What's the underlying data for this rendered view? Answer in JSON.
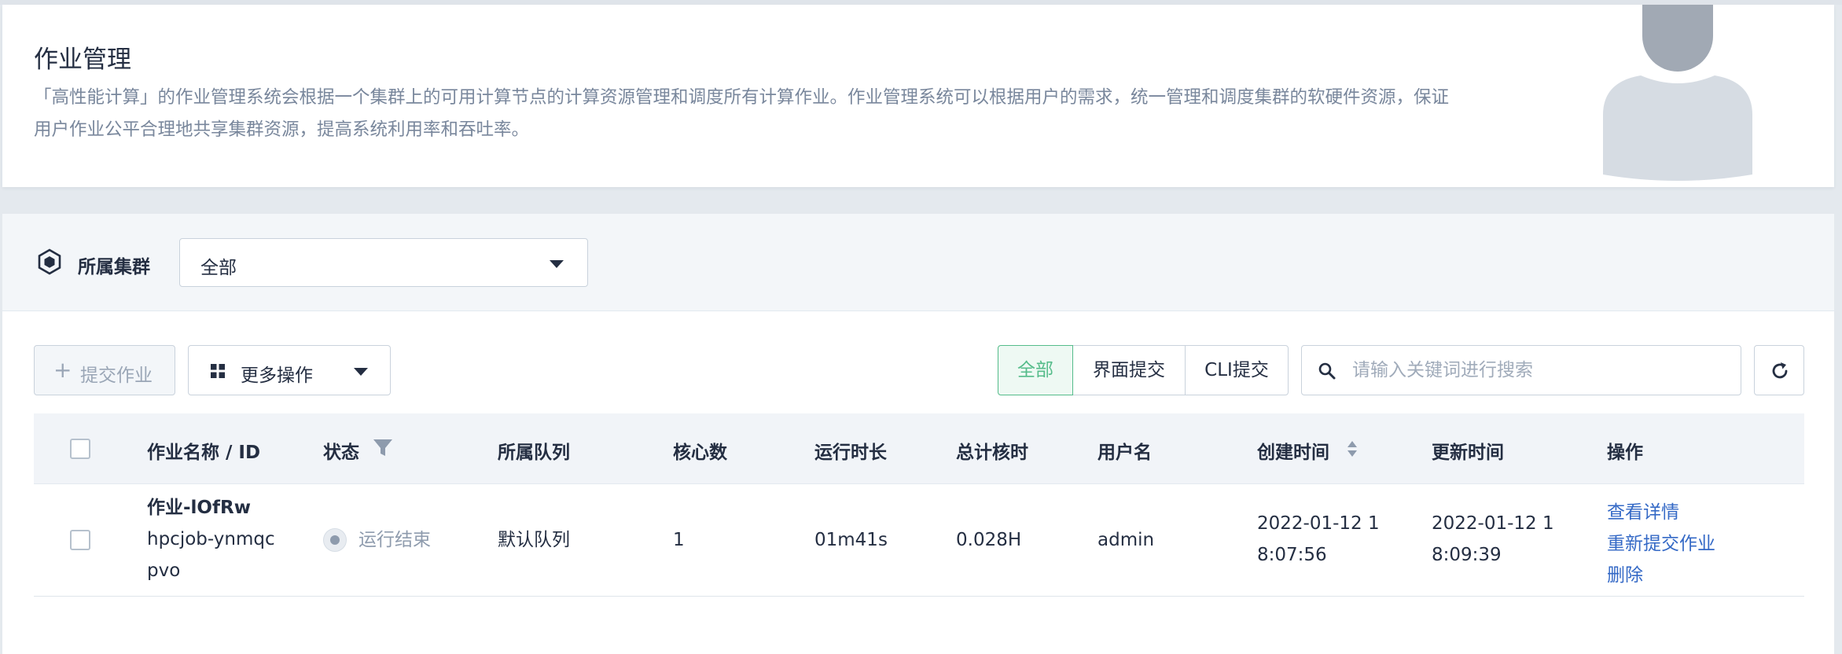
{
  "header": {
    "title": "作业管理",
    "description_line1": "「高性能计算」的作业管理系统会根据一个集群上的可用计算节点的计算资源管理和调度所有计算作业。作业管理系统可以根据用户的需求，统一管理和调度集群的软硬件资源，保证",
    "description_line2": "用户作业公平合理地共享集群资源，提高系统利用率和吞吐率。"
  },
  "cluster_filter": {
    "label": "所属集群",
    "selected": "全部",
    "icon": "cube-icon"
  },
  "toolbar": {
    "submit_label": "提交作业",
    "more_label": "更多操作",
    "segments": [
      "全部",
      "界面提交",
      "CLI提交"
    ],
    "active_segment": "全部",
    "search_placeholder": "请输入关键词进行搜索"
  },
  "table": {
    "columns": [
      "作业名称 / ID",
      "状态",
      "所属队列",
      "核心数",
      "运行时长",
      "总计核时",
      "用户名",
      "创建时间",
      "更新时间",
      "操作"
    ],
    "rows": [
      {
        "name": "作业-lOfRw",
        "id_line1": "hpcjob-ynmqc",
        "id_line2": "pvo",
        "status": "运行结束",
        "queue": "默认队列",
        "cores": "1",
        "duration": "01m41s",
        "core_hours": "0.028H",
        "user": "admin",
        "created_line1": "2022-01-12 1",
        "created_line2": "8:07:56",
        "updated_line1": "2022-01-12 1",
        "updated_line2": "8:09:39",
        "actions": [
          "查看详情",
          "重新提交作业",
          "删除"
        ]
      }
    ]
  },
  "colors": {
    "accent_green": "#55bc8a",
    "link_blue": "#3469c6",
    "text_primary": "#242e42",
    "text_secondary": "#79879c"
  }
}
